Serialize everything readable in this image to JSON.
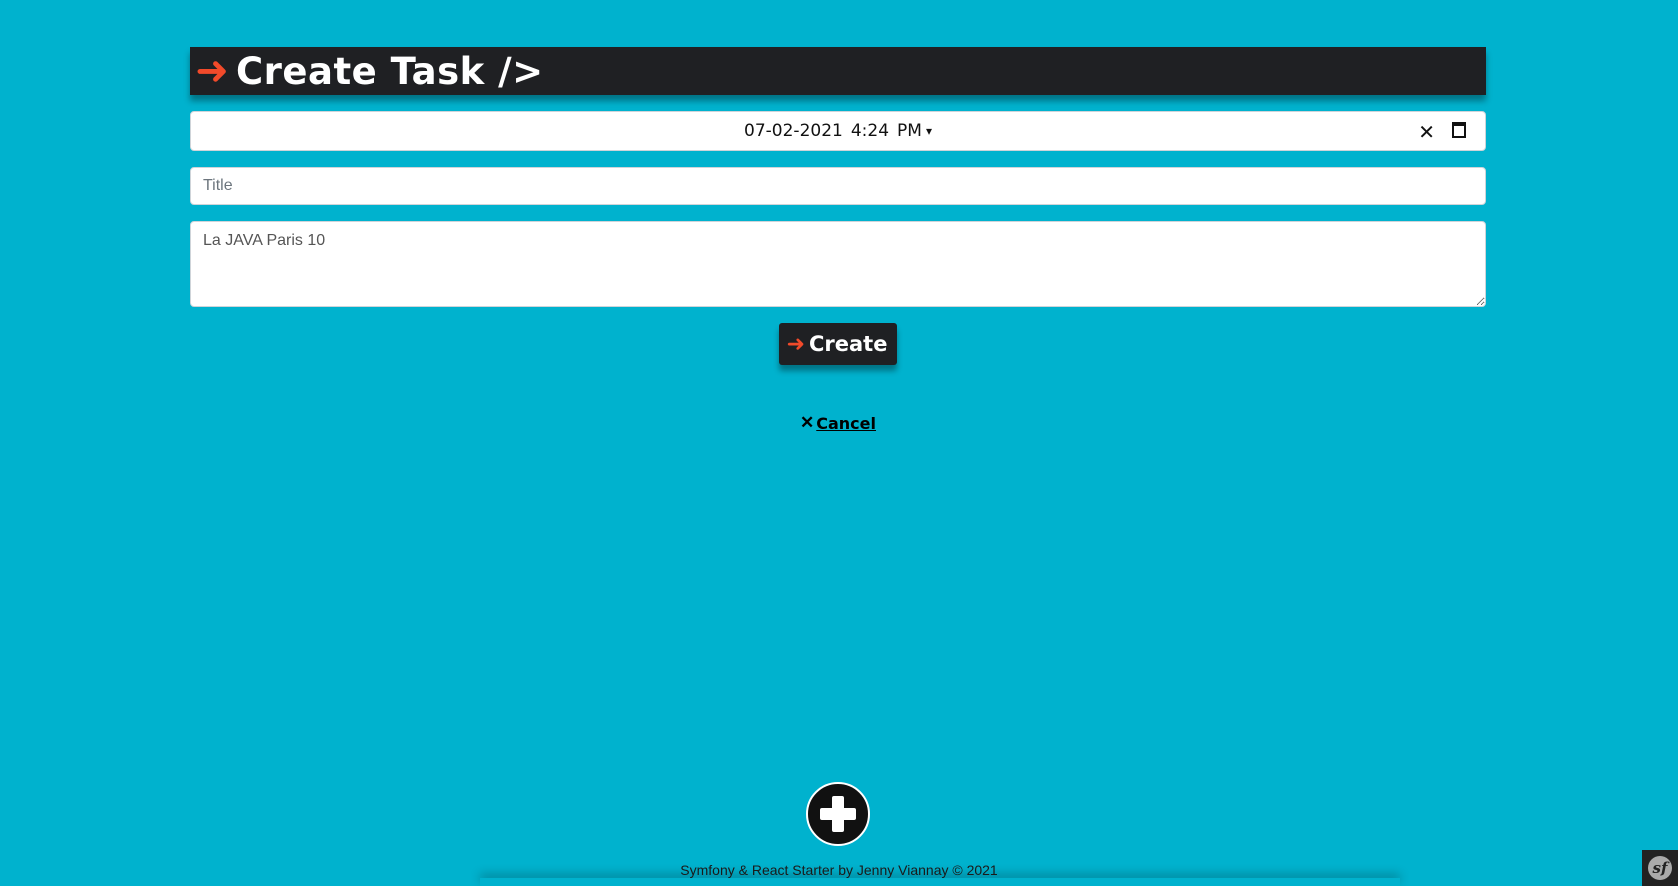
{
  "header": {
    "arrow": "➜",
    "title": "Create Task />"
  },
  "form": {
    "datetime": {
      "value": "07-02-2021 4:24  PM",
      "date": "07-02-2021",
      "time": "4:24",
      "period": "PM"
    },
    "title_placeholder": "Title",
    "description_value": "La JAVA Paris 10",
    "create_button": {
      "arrow": "➜",
      "label": "Create"
    },
    "cancel": {
      "icon": "✕",
      "label": "Cancel"
    }
  },
  "footer": {
    "text": "Symfony & React Starter by Jenny Viannay © 2021"
  },
  "icons": {
    "add": "plus-icon",
    "clear": "close-icon",
    "calendar": "calendar-icon",
    "symfony": "symfony-icon"
  },
  "colors": {
    "background": "#00b2ce",
    "bar": "#1f2023",
    "accent": "#f24a2a"
  }
}
